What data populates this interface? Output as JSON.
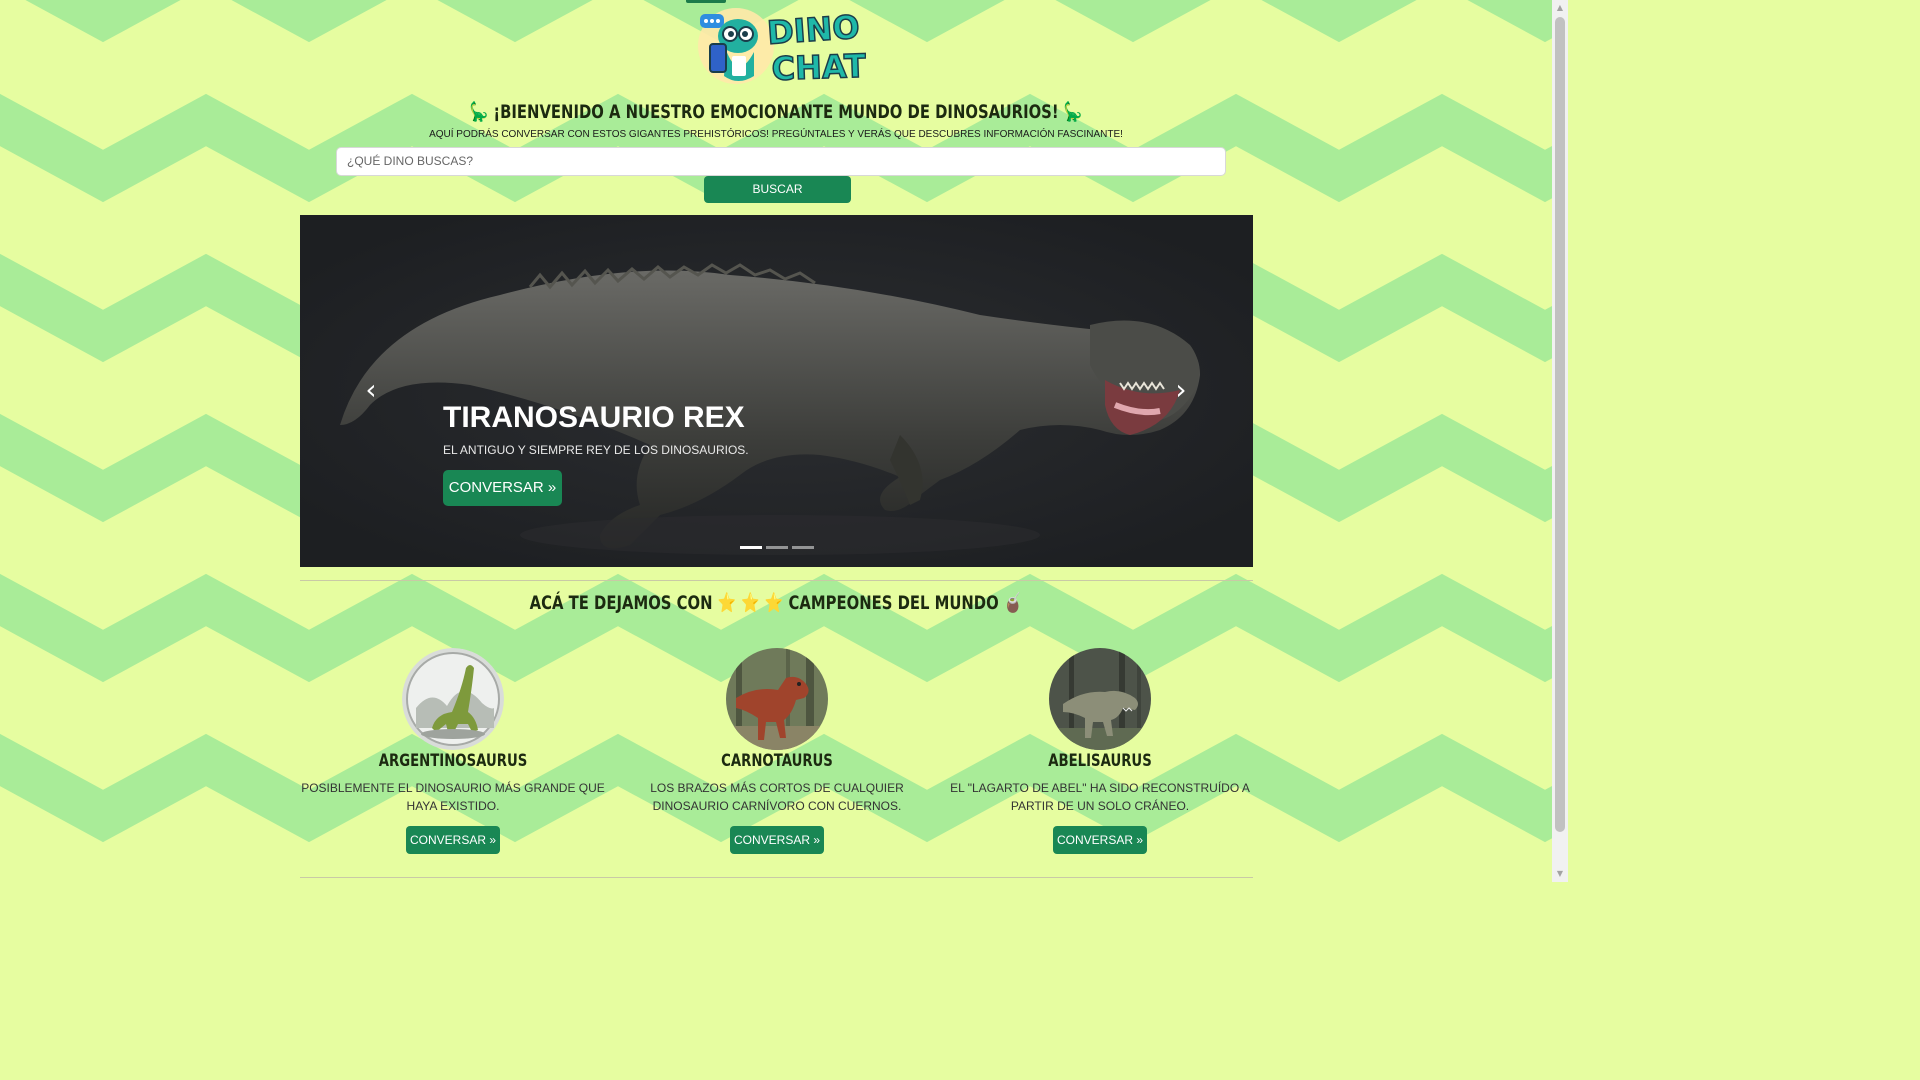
{
  "logo": {
    "line1": "DINO",
    "line2": "CHAT"
  },
  "welcome": {
    "emoji_left": "🦕",
    "text": "¡BIENVENIDO A NUESTRO EMOCIONANTE MUNDO DE DINOSAURIOS!",
    "emoji_right": "🦕"
  },
  "subtitle": "AQUÍ PODRÁS CONVERSAR CON ESTOS GIGANTES PREHISTÓRICOS! PREGÚNTALES Y VERÁS QUE DESCUBRES INFORMACIÓN FASCINANTE!",
  "search": {
    "placeholder": "¿QUÉ DINO BUSCAS?",
    "value": "",
    "button_label": "BUSCAR"
  },
  "carousel": {
    "title": "TIRANOSAURIO REX",
    "text": "EL ANTIGUO Y SIEMPRE REY DE LOS DINOSAURIOS.",
    "button_label": "CONVERSAR »",
    "prev_icon": "‹",
    "next_icon": "›",
    "slide_count": 3,
    "active_slide": 1
  },
  "section": {
    "text_left": "ACÁ TE DEJAMOS CON",
    "stars": "⭐ ⭐ ⭐",
    "text_right": "CAMPEONES DEL MUNDO",
    "emoji": "🧉"
  },
  "cards": [
    {
      "name": "ARGENTINOSAURUS",
      "desc": "POSIBLEMENTE EL DINOSAURIO MÁS GRANDE QUE HAYA EXISTIDO.",
      "button_label": "CONVERSAR »"
    },
    {
      "name": "CARNOTAURUS",
      "desc": "LOS BRAZOS MÁS CORTOS DE CUALQUIER DINOSAURIO CARNÍVORO CON CUERNOS.",
      "button_label": "CONVERSAR »"
    },
    {
      "name": "ABELISAURUS",
      "desc": "EL \"LAGARTO DE ABEL\" HA SIDO RECONSTRUÍDO A PARTIR DE UN SOLO CRÁNEO.",
      "button_label": "CONVERSAR »"
    }
  ],
  "colors": {
    "background_light": "#e6fda0",
    "background_chevron": "#a9ec98",
    "accent_green": "#198754",
    "carousel_bg": "#212529"
  }
}
